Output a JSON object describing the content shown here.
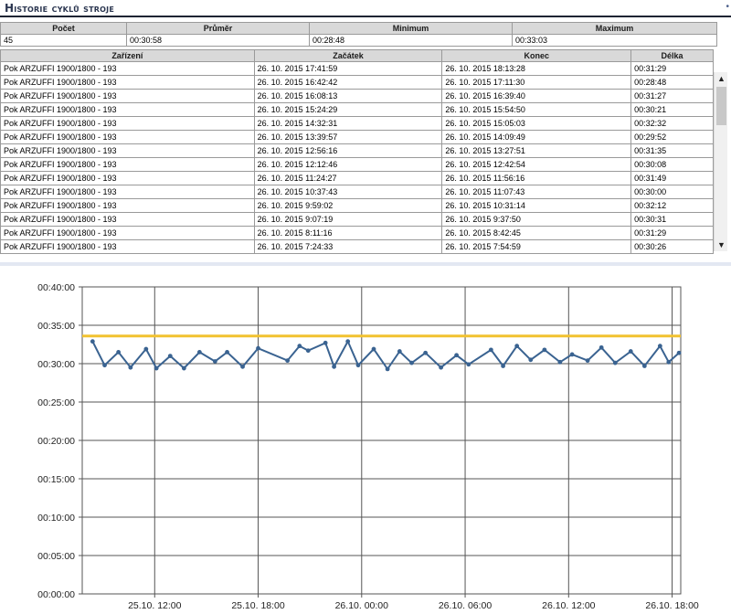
{
  "title": "Historie cyklů stroje",
  "summary": {
    "headers": [
      "Počet",
      "Průměr",
      "Minimum",
      "Maximum"
    ],
    "values": [
      "45",
      "00:30:58",
      "00:28:48",
      "00:33:03"
    ]
  },
  "list": {
    "headers": [
      "Zařízení",
      "Začátek",
      "Konec",
      "Délka"
    ],
    "rows": [
      [
        "Pok ARZUFFI 1900/1800 - 193",
        "26. 10. 2015 17:41:59",
        "26. 10. 2015 18:13:28",
        "00:31:29"
      ],
      [
        "Pok ARZUFFI 1900/1800 - 193",
        "26. 10. 2015 16:42:42",
        "26. 10. 2015 17:11:30",
        "00:28:48"
      ],
      [
        "Pok ARZUFFI 1900/1800 - 193",
        "26. 10. 2015 16:08:13",
        "26. 10. 2015 16:39:40",
        "00:31:27"
      ],
      [
        "Pok ARZUFFI 1900/1800 - 193",
        "26. 10. 2015 15:24:29",
        "26. 10. 2015 15:54:50",
        "00:30:21"
      ],
      [
        "Pok ARZUFFI 1900/1800 - 193",
        "26. 10. 2015 14:32:31",
        "26. 10. 2015 15:05:03",
        "00:32:32"
      ],
      [
        "Pok ARZUFFI 1900/1800 - 193",
        "26. 10. 2015 13:39:57",
        "26. 10. 2015 14:09:49",
        "00:29:52"
      ],
      [
        "Pok ARZUFFI 1900/1800 - 193",
        "26. 10. 2015 12:56:16",
        "26. 10. 2015 13:27:51",
        "00:31:35"
      ],
      [
        "Pok ARZUFFI 1900/1800 - 193",
        "26. 10. 2015 12:12:46",
        "26. 10. 2015 12:42:54",
        "00:30:08"
      ],
      [
        "Pok ARZUFFI 1900/1800 - 193",
        "26. 10. 2015 11:24:27",
        "26. 10. 2015 11:56:16",
        "00:31:49"
      ],
      [
        "Pok ARZUFFI 1900/1800 - 193",
        "26. 10. 2015 10:37:43",
        "26. 10. 2015 11:07:43",
        "00:30:00"
      ],
      [
        "Pok ARZUFFI 1900/1800 - 193",
        "26. 10. 2015 9:59:02",
        "26. 10. 2015 10:31:14",
        "00:32:12"
      ],
      [
        "Pok ARZUFFI 1900/1800 - 193",
        "26. 10. 2015 9:07:19",
        "26. 10. 2015 9:37:50",
        "00:30:31"
      ],
      [
        "Pok ARZUFFI 1900/1800 - 193",
        "26. 10. 2015 8:11:16",
        "26. 10. 2015 8:42:45",
        "00:31:29"
      ],
      [
        "Pok ARZUFFI 1900/1800 - 193",
        "26. 10. 2015 7:24:33",
        "26. 10. 2015 7:54:59",
        "00:30:26"
      ]
    ]
  },
  "scrollbar": {
    "up_icon": "chevron-up-icon",
    "down_icon": "chevron-down-icon"
  },
  "colors": {
    "title": "#2b3650",
    "series": "#3a6391",
    "threshold": "#f2c230",
    "grid": "#555555",
    "header_bg": "#d9d9d9"
  },
  "chart_data": {
    "type": "line",
    "y_tick_labels": [
      "00:40:00",
      "00:35:00",
      "00:30:00",
      "00:25:00",
      "00:20:00",
      "00:15:00",
      "00:10:00",
      "00:05:00",
      "00:00:00"
    ],
    "y_ticks_min": [
      40,
      35,
      30,
      25,
      20,
      15,
      10,
      5,
      0
    ],
    "ylim_min": [
      0,
      40
    ],
    "x_tick_labels": [
      "25.10. 12:00",
      "25.10. 18:00",
      "26.10. 00:00",
      "26.10. 06:00",
      "26.10. 12:00",
      "26.10. 18:00"
    ],
    "x_ticks_h": [
      12,
      18,
      24,
      30,
      36,
      42
    ],
    "xlim_h": [
      7.8,
      42.5
    ],
    "grid": true,
    "threshold_min": 33.6,
    "series": [
      {
        "x_h": [
          8.4,
          9.1,
          9.9,
          10.6,
          11.5,
          12.1,
          12.9,
          13.7,
          14.6,
          15.5,
          16.2,
          17.1,
          18.0,
          19.7,
          20.4,
          20.9,
          21.9,
          22.4,
          23.2,
          23.8,
          24.7,
          25.5,
          26.2,
          26.9,
          27.7,
          28.6,
          29.5,
          30.2,
          31.5,
          32.2,
          33.0,
          33.8,
          34.6,
          35.5,
          36.2,
          37.1,
          37.9,
          38.7,
          39.6,
          40.4,
          41.3,
          41.8,
          42.4
        ],
        "y_min": [
          32.9,
          29.8,
          31.5,
          29.5,
          31.9,
          29.4,
          31.0,
          29.4,
          31.5,
          30.3,
          31.5,
          29.6,
          32.0,
          30.4,
          32.3,
          31.7,
          32.7,
          29.6,
          32.9,
          29.8,
          31.9,
          29.3,
          31.6,
          30.1,
          31.4,
          29.5,
          31.1,
          29.9,
          31.8,
          29.7,
          32.3,
          30.5,
          31.8,
          30.2,
          31.2,
          30.4,
          32.1,
          30.1,
          31.6,
          29.7,
          32.3,
          30.2,
          31.4,
          28.8,
          31.3
        ]
      }
    ]
  }
}
